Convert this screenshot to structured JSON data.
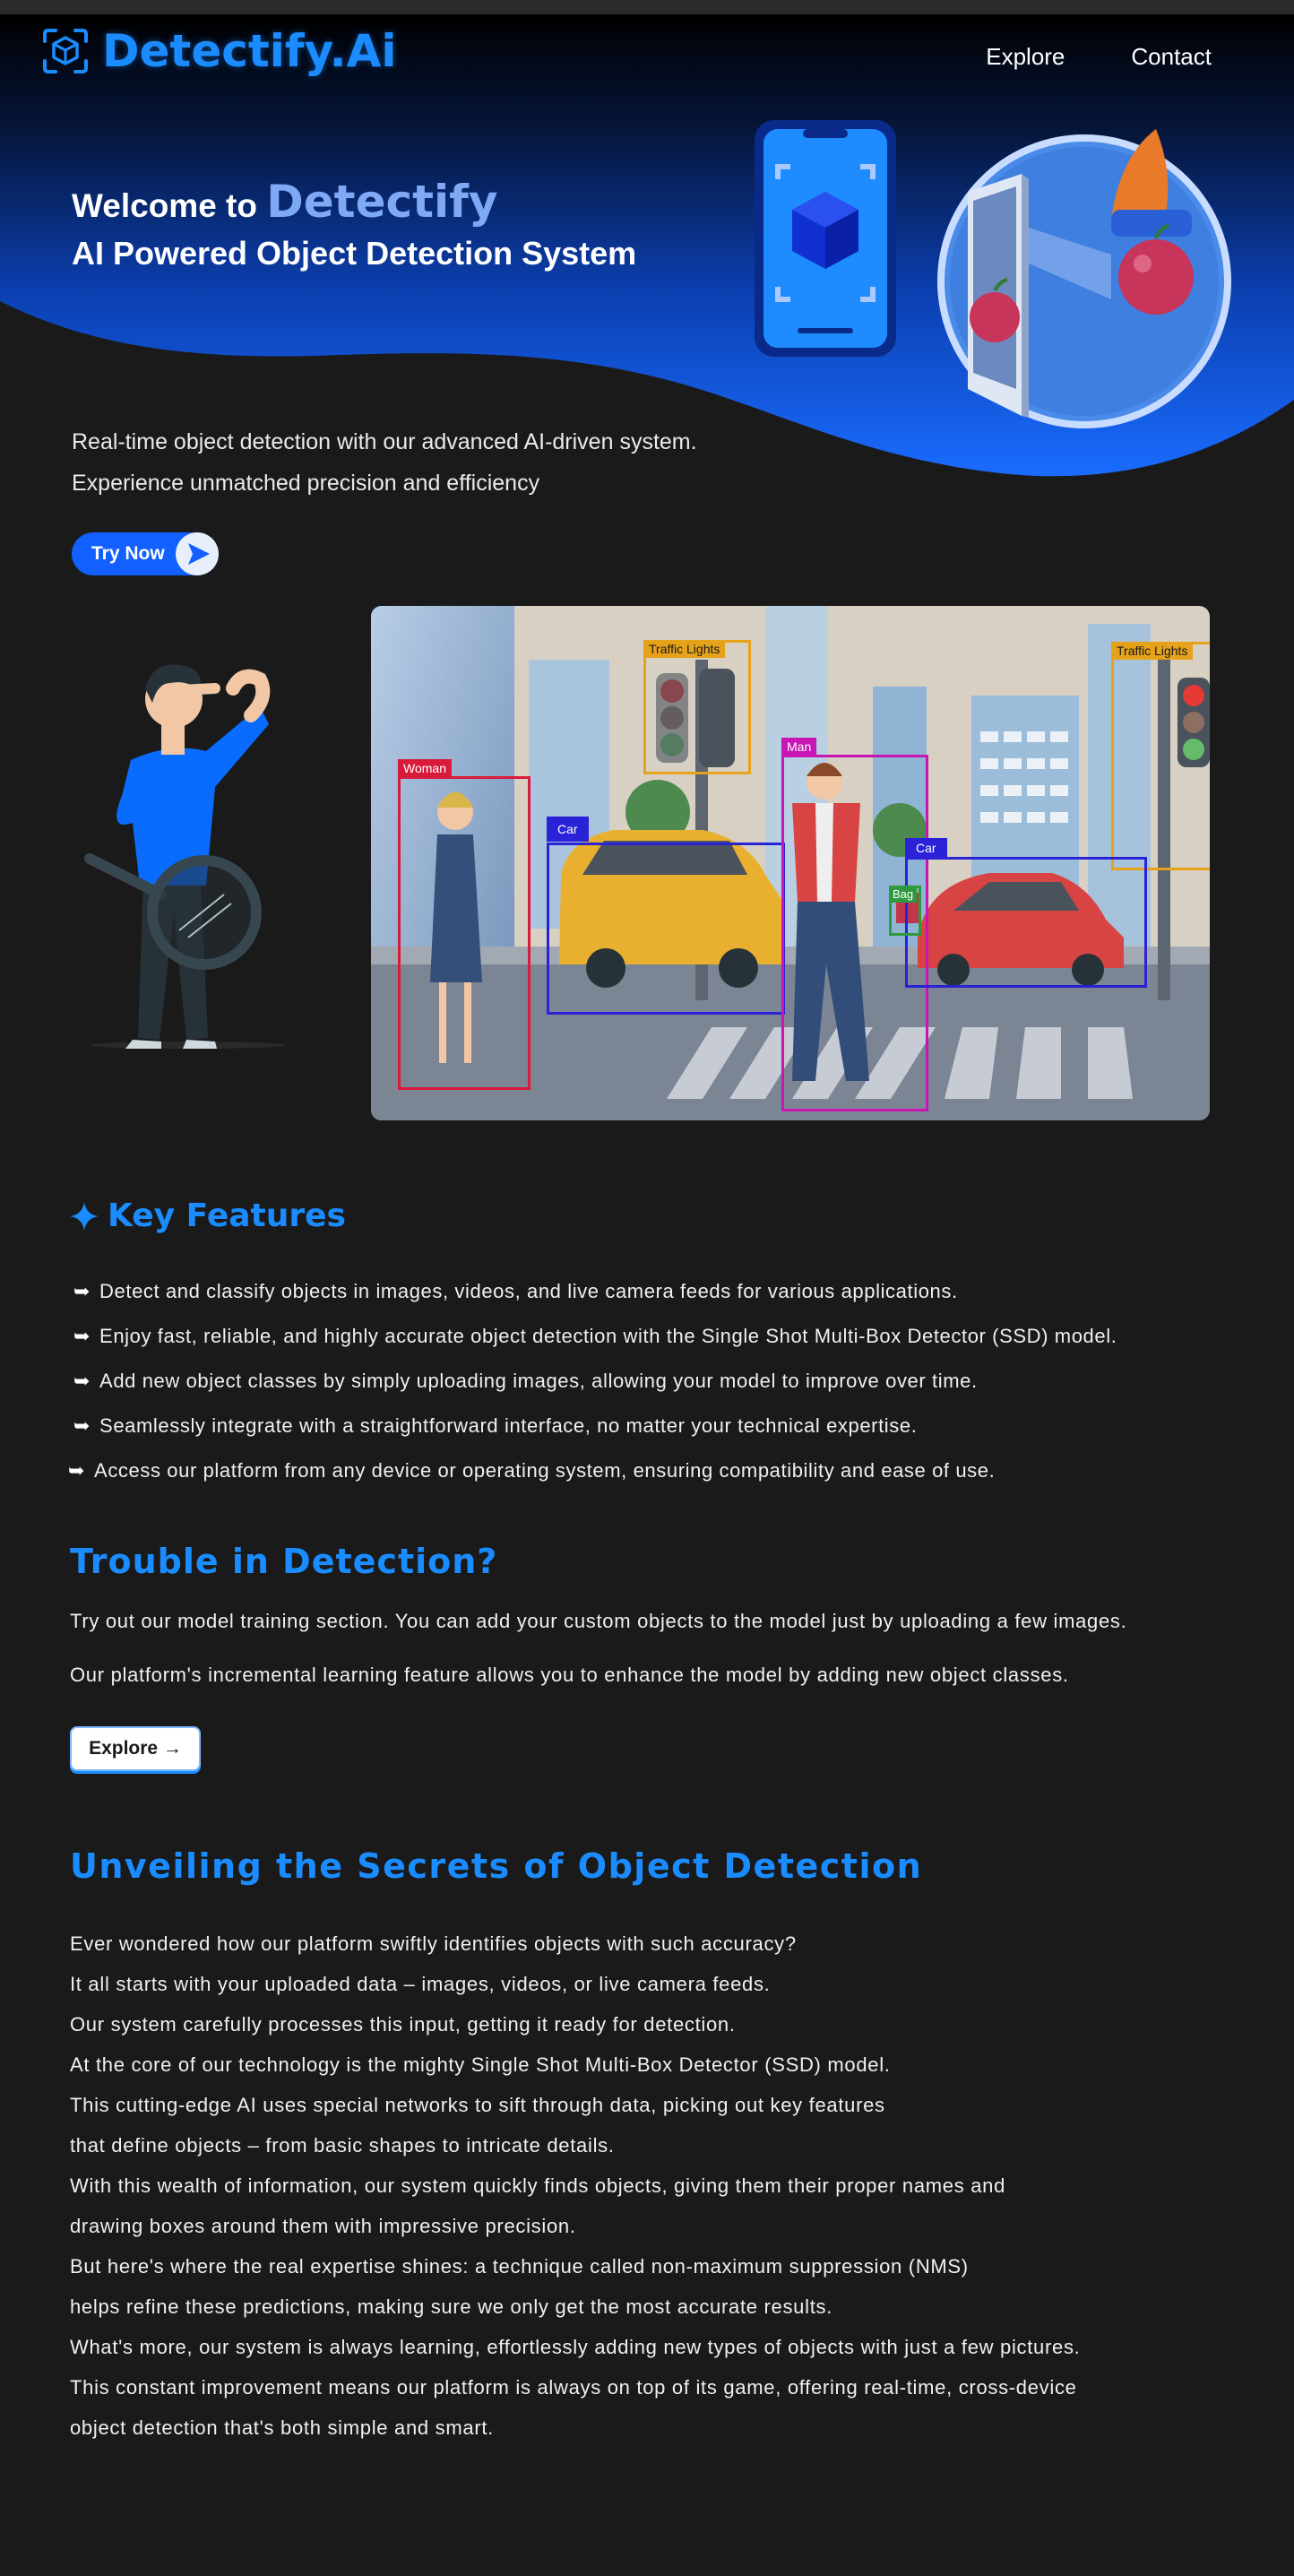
{
  "header": {
    "logo_text": "Detectify.Ai",
    "nav": [
      {
        "label": "Explore"
      },
      {
        "label": "Contact"
      }
    ]
  },
  "hero": {
    "welcome_prefix": "Welcome to",
    "welcome_brand": "Detectify",
    "subtitle": "AI Powered Object Detection System",
    "intro_lines": [
      "Real-time object detection with our advanced AI-driven system.",
      "Experience unmatched precision and efficiency"
    ],
    "try_button": "Try Now"
  },
  "scene": {
    "labels": {
      "traffic1": "Traffic Lights",
      "traffic2": "Traffic Lights",
      "woman": "Woman",
      "man": "Man",
      "car1": "Car",
      "car2": "Car",
      "bag": "Bag"
    }
  },
  "features": {
    "title": "Key Features",
    "items": [
      "Detect and classify objects in images, videos, and live camera feeds for various applications.",
      "Enjoy fast, reliable, and highly accurate object detection with the Single Shot Multi-Box Detector (SSD) model.",
      "Add new object classes by simply uploading images, allowing your model to improve over time.",
      "Seamlessly integrate with a straightforward interface, no matter your technical expertise.",
      "Access our platform from any device or operating system, ensuring compatibility and ease of use."
    ]
  },
  "trouble": {
    "title": "Trouble in Detection?",
    "p1": "Try out our model training section. You can add your custom objects to the model just by uploading a few images.",
    "p2": "Our platform's incremental learning feature allows you to enhance the model by adding new object classes.",
    "button": "Explore →"
  },
  "unveil": {
    "title": "Unveiling the Secrets of Object Detection",
    "lines": [
      "Ever wondered how our platform swiftly identifies objects with such accuracy?",
      "It all starts with your uploaded data – images, videos, or live camera feeds.",
      "Our system carefully processes this input, getting it ready for detection.",
      "At the core of our technology is the mighty Single Shot Multi-Box Detector (SSD) model.",
      "This cutting-edge AI uses special networks to sift through data, picking out key features",
      "that define objects – from basic shapes to intricate details.",
      "With this wealth of information, our system quickly finds objects, giving them their proper names and",
      "drawing boxes around them with impressive precision.",
      "But here's where the real expertise shines: a technique called non-maximum suppression (NMS)",
      "helps refine these predictions, making sure we only get the most accurate results.",
      "What's more, our system is always learning, effortlessly adding new types of objects with just a few pictures.",
      "This constant improvement means our platform is always on top of its game, offering real-time, cross-device",
      "object detection that's both simple and smart."
    ]
  },
  "colors": {
    "accent": "#1a8cff",
    "button_blue": "#1160ff",
    "background": "#1a1a1a"
  }
}
